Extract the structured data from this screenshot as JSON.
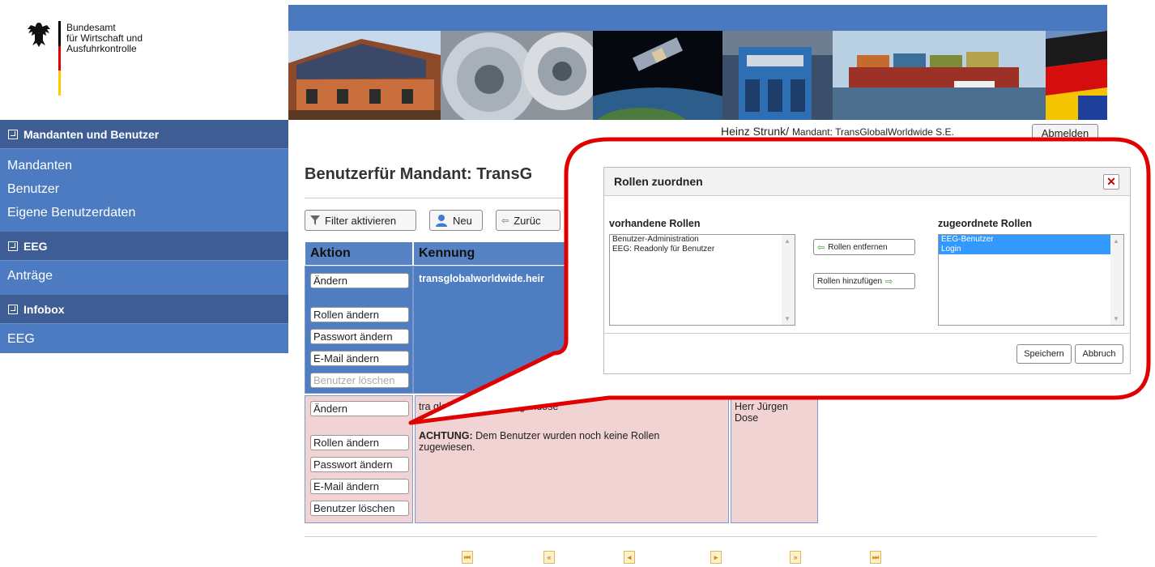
{
  "logo": {
    "line1": "Bundesamt",
    "line2": "für Wirtschaft und",
    "line3": "Ausfuhrkontrolle",
    "flag_colors": [
      "#000000",
      "#dd0000",
      "#ffcc00"
    ]
  },
  "header": {
    "user_name": "Heinz Strunk/",
    "mandant_label": "Mandant: TransGlobalWorldwide S.E.",
    "logout_label": "Abmelden"
  },
  "sidebar": {
    "sections": [
      {
        "label": "Mandanten und Benutzer",
        "items": [
          "Mandanten",
          "Benutzer",
          "Eigene Benutzerdaten"
        ]
      },
      {
        "label": "EEG",
        "items": [
          "Anträge"
        ]
      },
      {
        "label": "Infobox",
        "items": [
          "EEG"
        ]
      }
    ]
  },
  "page": {
    "title": "Benutzerfür Mandant: TransG"
  },
  "toolbar": {
    "filter_label": "Filter aktivieren",
    "new_label": "Neu",
    "back_label": "Zurüc"
  },
  "table": {
    "headers": [
      "Aktion",
      "Kennung"
    ],
    "rows": [
      {
        "actions": [
          "Ändern",
          "Rollen ändern",
          "Passwort ändern",
          "E-Mail ändern",
          "Benutzer löschen"
        ],
        "kennung": "transglobalworldwide.heir"
      },
      {
        "actions": [
          "Ändern",
          "Rollen ändern",
          "Passwort ändern",
          "E-Mail ändern",
          "Benutzer löschen"
        ],
        "kennung": "tra  globalworldwide.jürgendose",
        "warning_prefix": "ACHTUNG:",
        "warning_text": "Dem Benutzer wurden noch keine Rollen zugewiesen.",
        "name_line1": "Herr Jürgen",
        "name_line2": "Dose"
      }
    ]
  },
  "pager": [
    "first",
    "prev-page",
    "prev",
    "next",
    "next-page",
    "last"
  ],
  "dialog": {
    "title": "Rollen zuordnen",
    "available_label": "vorhandene Rollen",
    "assigned_label": "zugeordnete Rollen",
    "available_roles": [
      "Benutzer-Administration",
      "EEG: Readonly für Benutzer"
    ],
    "assigned_roles": [
      "EEG-Benutzer",
      "Login"
    ],
    "remove_label": "Rollen entfernen",
    "add_label": "Rollen hinzufügen",
    "save_label": "Speichern",
    "cancel_label": "Abbruch"
  },
  "colors": {
    "sidebar_bg": "#4c7bc1",
    "section_header": "#3d5d94",
    "row_highlight": "#4f7dc2",
    "row_warning": "#f2d3d3",
    "callout_red": "#e00000",
    "selection_blue": "#3399ff"
  }
}
